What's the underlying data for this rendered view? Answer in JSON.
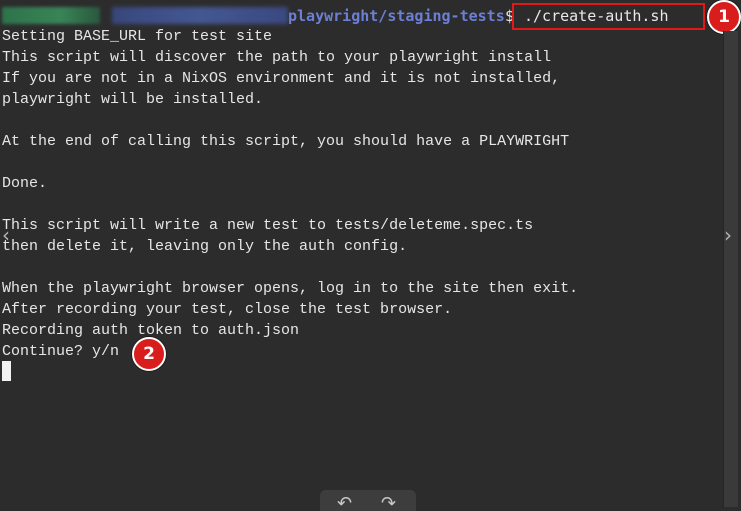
{
  "prompt": {
    "path": "playwright/staging-tests",
    "sign": "$",
    "command": "./create-auth.sh"
  },
  "annotations": {
    "badge_1": "1",
    "badge_2": "2",
    "highlight_color": "#e01818",
    "badge_color": "#d91d1d"
  },
  "output_lines": [
    "Setting BASE_URL for test site",
    "This script will discover the path to your playwright install",
    "If you are not in a NixOS environment and it is not installed,",
    "playwright will be installed.",
    "",
    "At the end of calling this script, you should have a PLAYWRIGHT",
    "",
    "Done.",
    "",
    "This script will write a new test to tests/deleteme.spec.ts",
    "then delete it, leaving only the auth config.",
    "",
    "When the playwright browser opens, log in to the site then exit.",
    "After recording your test, close the test browser.",
    "Recording auth token to auth.json",
    "Continue? y/n"
  ],
  "icons": {
    "left_nav": "chevron-left-icon",
    "right_nav": "chevron-right-icon",
    "undo": "undo-icon",
    "redo": "redo-icon"
  },
  "colors": {
    "background": "#2c2c2c",
    "text": "#e6e6e6",
    "path": "#6c7fd6"
  }
}
